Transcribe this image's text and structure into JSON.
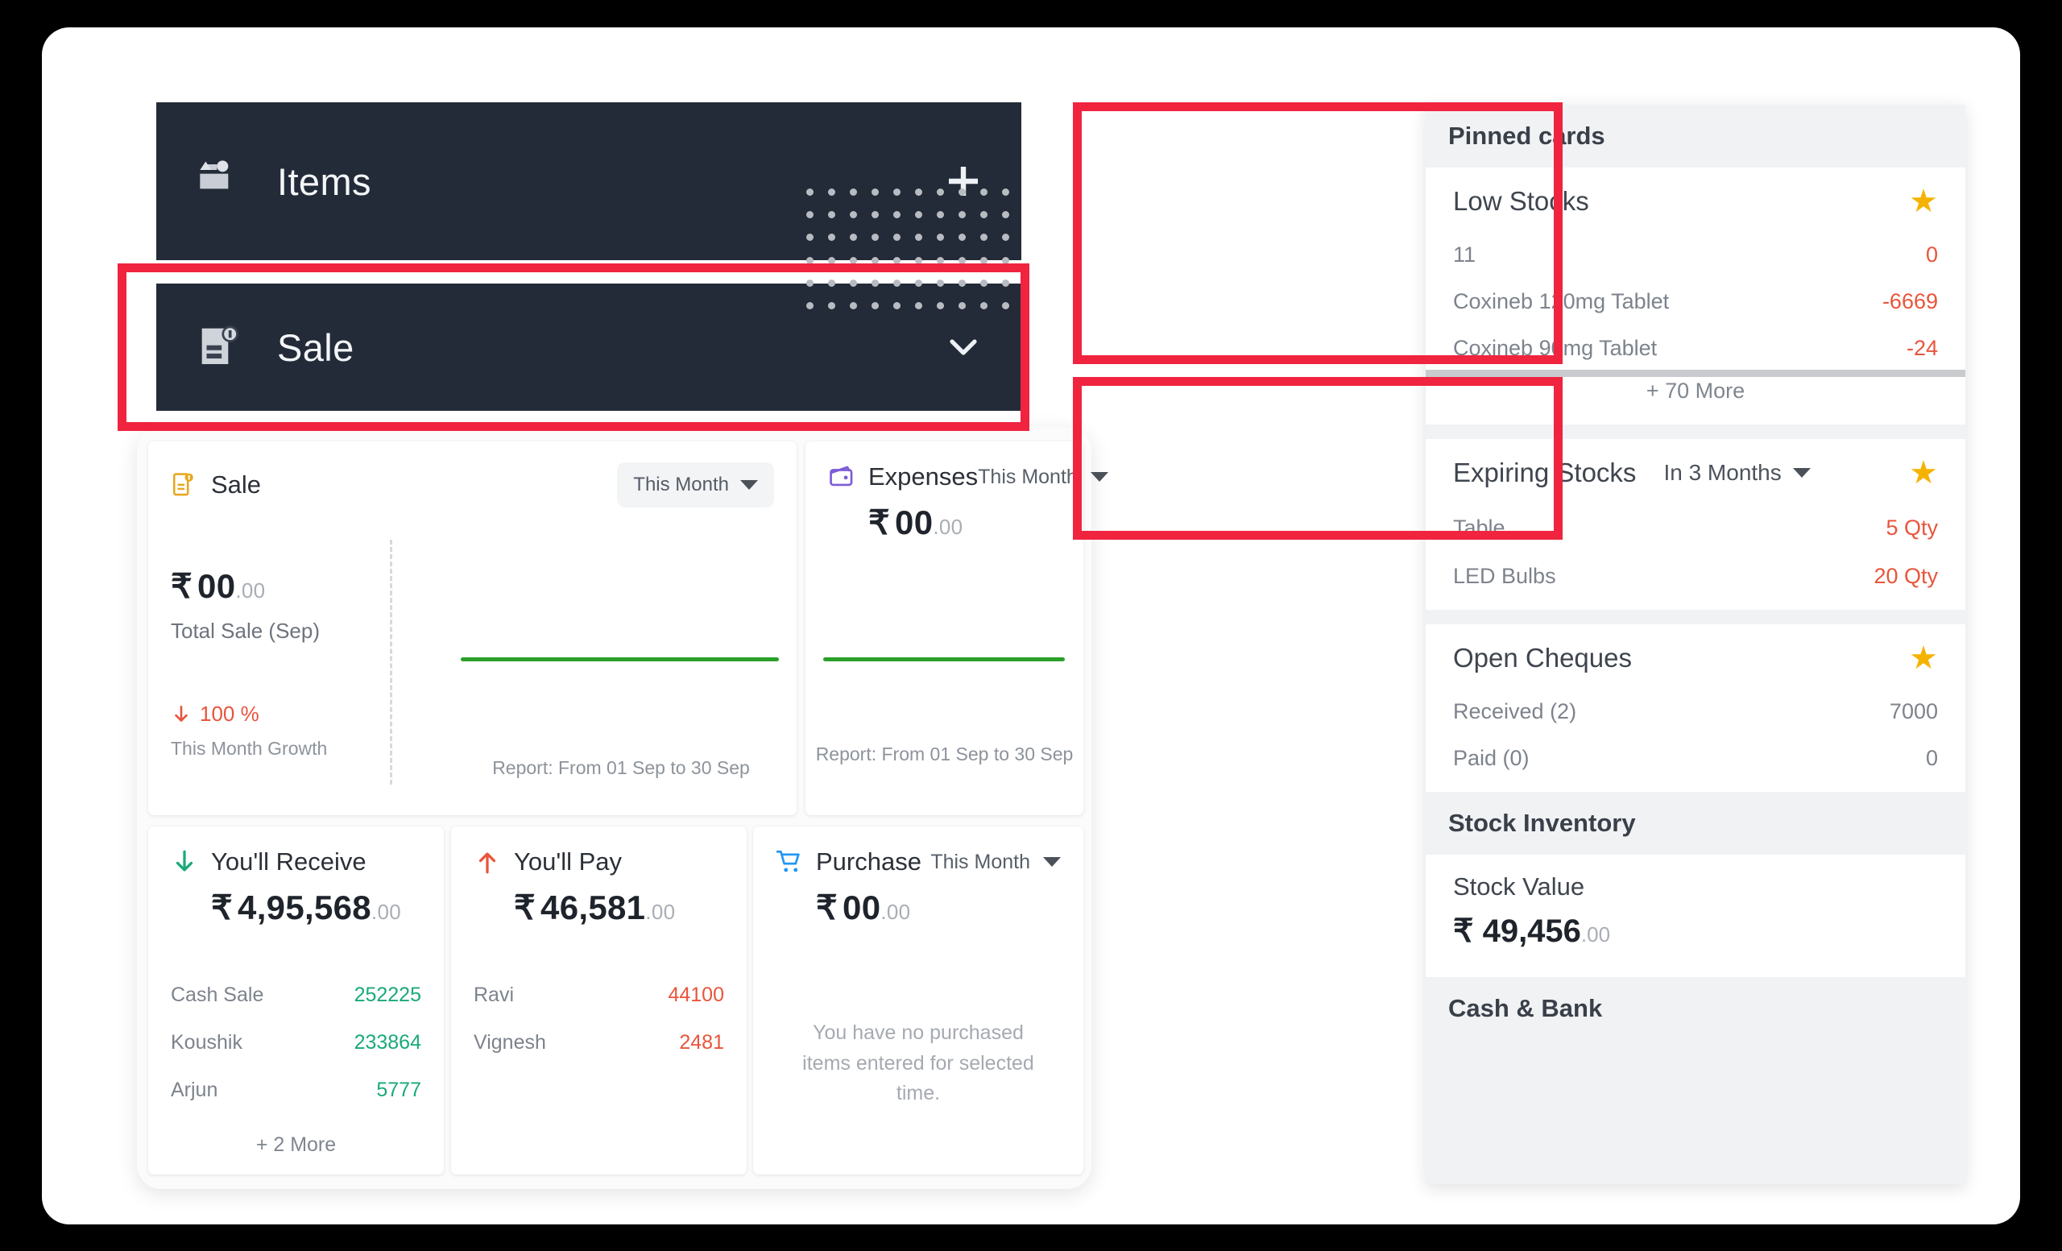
{
  "nav": {
    "items": {
      "label": "Items",
      "icon": "items-box-icon",
      "action": "plus-icon"
    },
    "sale": {
      "label": "Sale",
      "icon": "sale-invoice-icon",
      "action": "chevron-down-icon"
    }
  },
  "board": {
    "sale_card": {
      "title": "Sale",
      "icon": "sale-invoice-icon",
      "period": "This Month",
      "amount_currency": "₹",
      "amount_main": "00",
      "amount_dec": ".00",
      "total_label": "Total Sale (Sep)",
      "growth_value": "100 %",
      "growth_label": "This Month Growth",
      "growth_direction": "down",
      "report": "Report: From 01 Sep to 30 Sep"
    },
    "expenses_card": {
      "title": "Expenses",
      "icon": "wallet-icon",
      "period": "This Month",
      "amount_currency": "₹",
      "amount_main": "00",
      "amount_dec": ".00",
      "report": "Report: From 01 Sep to 30 Sep"
    },
    "receive_card": {
      "title": "You'll Receive",
      "icon": "arrow-down-icon",
      "amount_currency": "₹",
      "amount_main": "4,95,568",
      "amount_dec": ".00",
      "rows": [
        {
          "name": "Cash Sale",
          "value": "252225"
        },
        {
          "name": "Koushik",
          "value": "233864"
        },
        {
          "name": "Arjun",
          "value": "5777"
        }
      ],
      "more": "+ 2 More",
      "value_color": "#1aa97a"
    },
    "pay_card": {
      "title": "You'll Pay",
      "icon": "arrow-up-icon",
      "amount_currency": "₹",
      "amount_main": "46,581",
      "amount_dec": ".00",
      "rows": [
        {
          "name": "Ravi",
          "value": "44100"
        },
        {
          "name": "Vignesh",
          "value": "2481"
        }
      ],
      "value_color": "#e8553c"
    },
    "purchase_card": {
      "title": "Purchase",
      "icon": "shopping-cart-icon",
      "period": "This Month",
      "amount_currency": "₹",
      "amount_main": "00",
      "amount_dec": ".00",
      "empty_message": "You have no purchased items entered for selected time."
    }
  },
  "right_panel": {
    "pinned_header": "Pinned cards",
    "low_stocks": {
      "title": "Low Stocks",
      "star": "★",
      "rows": [
        {
          "name": "11",
          "value": "0"
        },
        {
          "name": "Coxineb 120mg Tablet",
          "value": "-6669"
        },
        {
          "name": "Coxineb 90mg Tablet",
          "value": "-24"
        }
      ],
      "more": "+ 70 More"
    },
    "expiring_stocks": {
      "title": "Expiring Stocks",
      "period": "In 3 Months",
      "star": "★",
      "rows": [
        {
          "name": "Table",
          "value": "5 Qty"
        },
        {
          "name": "LED Bulbs",
          "value": "20 Qty"
        }
      ]
    },
    "open_cheques": {
      "title": "Open Cheques",
      "star": "★",
      "rows": [
        {
          "name": "Received (2)",
          "value": "7000"
        },
        {
          "name": "Paid (0)",
          "value": "0"
        }
      ]
    },
    "stock_inventory_header": "Stock Inventory",
    "stock_value": {
      "label": "Stock Value",
      "amount_currency": "₹",
      "amount_main": "49,456",
      "amount_dec": ".00"
    },
    "cash_bank_header": "Cash & Bank"
  },
  "colors": {
    "highlight": "#f0243f",
    "nav_bg": "#242b38",
    "star": "#f5b301",
    "positive": "#1aa97a",
    "negative": "#e8553c",
    "trend_line": "#2aa02a"
  }
}
